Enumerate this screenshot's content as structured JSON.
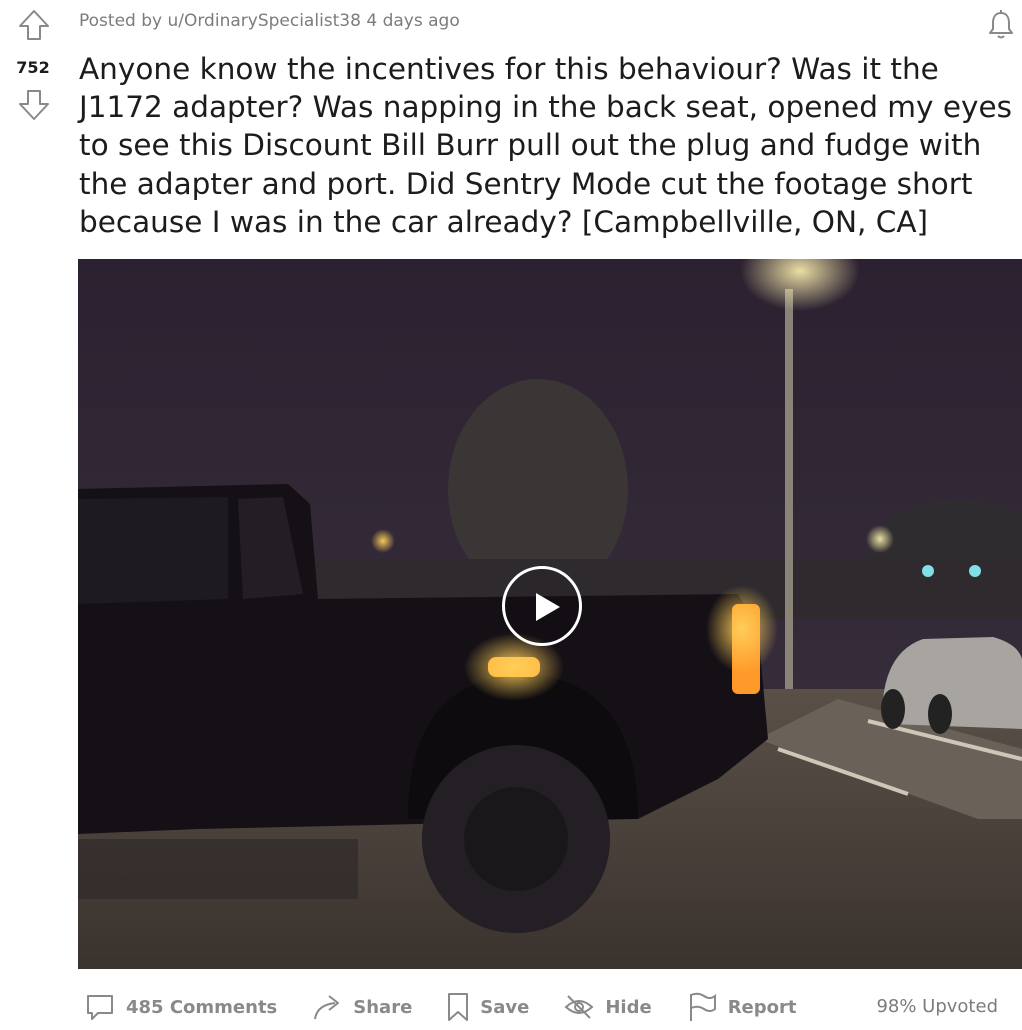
{
  "post": {
    "score": "752",
    "posted_by_prefix": "Posted by",
    "author": "u/OrdinarySpecialist38",
    "time": "4 days ago",
    "title": "Anyone know the incentives for this behaviour? Was it the J1172 adapter? Was napping in the back seat, opened my eyes to see this Discount Bill Burr pull out the plug and fudge with the adapter and port. Did Sentry Mode cut the footage short because I was in the car already? [Campbellville, ON, CA]"
  },
  "actions": {
    "comments": "485 Comments",
    "share": "Share",
    "save": "Save",
    "hide": "Hide",
    "report": "Report",
    "upvoted": "98% Upvoted"
  },
  "icons": [
    "upvote-arrow-icon",
    "downvote-arrow-icon",
    "bell-icon",
    "play-icon",
    "comment-icon",
    "share-icon",
    "bookmark-icon",
    "hide-eye-icon",
    "flag-icon"
  ],
  "colors": {
    "text": "#1c1c1c",
    "meta": "#7c7c7c",
    "action": "#878a8c"
  }
}
